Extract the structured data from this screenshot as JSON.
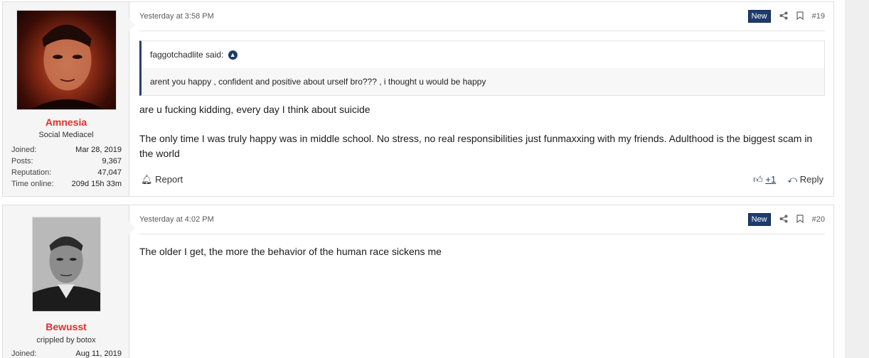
{
  "posts": [
    {
      "username": "Amnesia",
      "user_title": "Social Mediacel",
      "stats": [
        {
          "label": "Joined:",
          "value": "Mar 28, 2019"
        },
        {
          "label": "Posts:",
          "value": "9,367"
        },
        {
          "label": "Reputation:",
          "value": "47,047"
        },
        {
          "label": "Time online:",
          "value": "209d 15h 33m"
        }
      ],
      "date": "Yesterday at 3:58 PM",
      "badge": "New",
      "number": "#19",
      "quote": {
        "author": "faggotchadlite said:",
        "text": "arent you happy , confident and positive about urself bro??? , i thought u would be happy"
      },
      "message_lines": [
        "are u fucking kidding, every day I think about suicide",
        "The only time I was truly happy was in middle school. No stress, no real responsibilities just funmaxxing with my friends. Adulthood is the biggest scam in the world"
      ],
      "report_label": "Report",
      "like_count": "+1",
      "reply_label": "Reply"
    },
    {
      "username": "Bewusst",
      "user_title": "crippled by botox",
      "stats": [
        {
          "label": "Joined:",
          "value": "Aug 11, 2019"
        }
      ],
      "date": "Yesterday at 4:02 PM",
      "badge": "New",
      "number": "#20",
      "message_lines": [
        "The older I get, the more the behavior of the human race sickens me"
      ]
    }
  ],
  "colors": {
    "username": "#e0302f",
    "badge_bg": "#1d3b6e",
    "quote_bar": "#2a3f6b"
  }
}
